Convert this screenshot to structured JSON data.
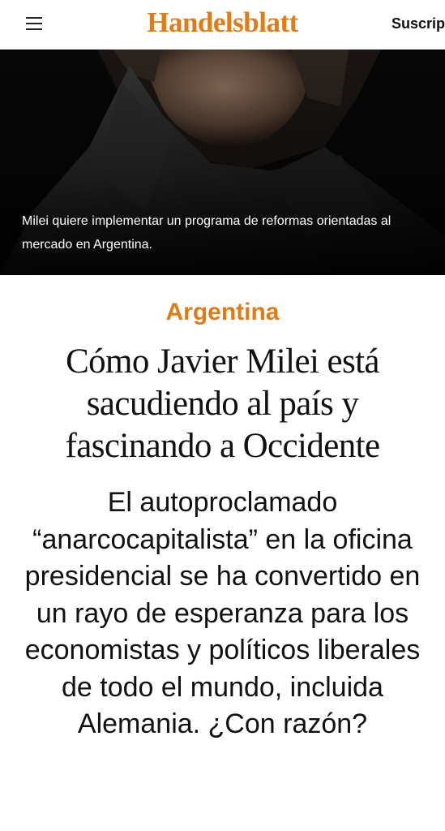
{
  "header": {
    "brand": "Handelsblatt",
    "subscribe_label": "Suscrip"
  },
  "hero": {
    "caption": "Milei quiere implementar un programa de reformas orientadas al mercado en Argentina."
  },
  "article": {
    "category": "Argentina",
    "headline": "Cómo Javier Milei está sacudiendo al país y fascinando a Occidente",
    "lead": "El autoproclamado “anarcocapitalista” en la oficina presidencial se ha convertido en un rayo de esperanza para los economistas y políticos liberales de todo el mundo, incluida Alemania. ¿Con razón?"
  },
  "colors": {
    "brand": "#e07b15",
    "hero_background": "#070707"
  },
  "icons": [
    "hamburger-menu-icon"
  ]
}
